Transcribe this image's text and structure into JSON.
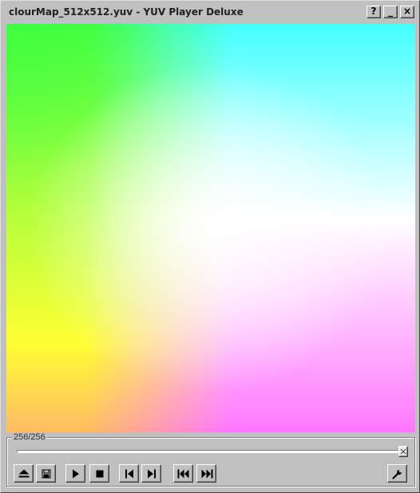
{
  "window": {
    "title": "clourMap_512x512.yuv - YUV Player Deluxe",
    "help_label": "?",
    "minimize_label": "_",
    "close_label": "×"
  },
  "player": {
    "frame_counter": "256/256",
    "progress": 1.0,
    "buttons": [
      {
        "name": "eject-button",
        "icon": "eject-icon"
      },
      {
        "name": "save-button",
        "icon": "save-icon"
      },
      {
        "name": "play-button",
        "icon": "play-icon"
      },
      {
        "name": "stop-button",
        "icon": "stop-icon"
      },
      {
        "name": "step-back-button",
        "icon": "step-back-icon"
      },
      {
        "name": "step-forward-button",
        "icon": "step-forward-icon"
      },
      {
        "name": "rewind-button",
        "icon": "rewind-icon"
      },
      {
        "name": "fast-forward-button",
        "icon": "fast-forward-icon"
      },
      {
        "name": "settings-button",
        "icon": "wrench-icon"
      }
    ]
  },
  "colors": {
    "window_bg": "#c0c0c0",
    "video_top_left": "#44ff44",
    "video_top_right": "#44ffff",
    "video_bottom_left": "#ffbb44",
    "video_bottom_right": "#ff77ff"
  }
}
